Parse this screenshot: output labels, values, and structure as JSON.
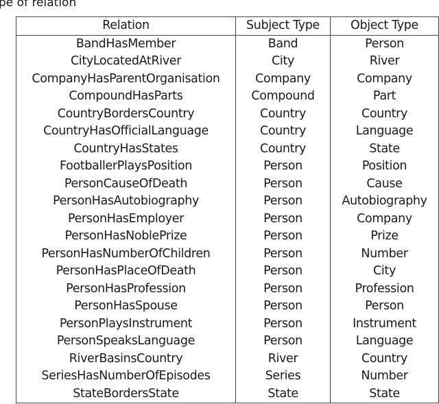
{
  "caption": "pe of relation",
  "table": {
    "headers": [
      "Relation",
      "Subject Type",
      "Object Type"
    ],
    "rows": [
      [
        "BandHasMember",
        "Band",
        "Person"
      ],
      [
        "CityLocatedAtRiver",
        "City",
        "River"
      ],
      [
        "CompanyHasParentOrganisation",
        "Company",
        "Company"
      ],
      [
        "CompoundHasParts",
        "Compound",
        "Part"
      ],
      [
        "CountryBordersCountry",
        "Country",
        "Country"
      ],
      [
        "CountryHasOfficialLanguage",
        "Country",
        "Language"
      ],
      [
        "CountryHasStates",
        "Country",
        "State"
      ],
      [
        "FootballerPlaysPosition",
        "Person",
        "Position"
      ],
      [
        "PersonCauseOfDeath",
        "Person",
        "Cause"
      ],
      [
        "PersonHasAutobiography",
        "Person",
        "Autobiography"
      ],
      [
        "PersonHasEmployer",
        "Person",
        "Company"
      ],
      [
        "PersonHasNoblePrize",
        "Person",
        "Prize"
      ],
      [
        "PersonHasNumberOfChildren",
        "Person",
        "Number"
      ],
      [
        "PersonHasPlaceOfDeath",
        "Person",
        "City"
      ],
      [
        "PersonHasProfession",
        "Person",
        "Profession"
      ],
      [
        "PersonHasSpouse",
        "Person",
        "Person"
      ],
      [
        "PersonPlaysInstrument",
        "Person",
        "Instrument"
      ],
      [
        "PersonSpeaksLanguage",
        "Person",
        "Language"
      ],
      [
        "RiverBasinsCountry",
        "River",
        "Country"
      ],
      [
        "SeriesHasNumberOfEpisodes",
        "Series",
        "Number"
      ],
      [
        "StateBordersState",
        "State",
        "State"
      ]
    ]
  }
}
